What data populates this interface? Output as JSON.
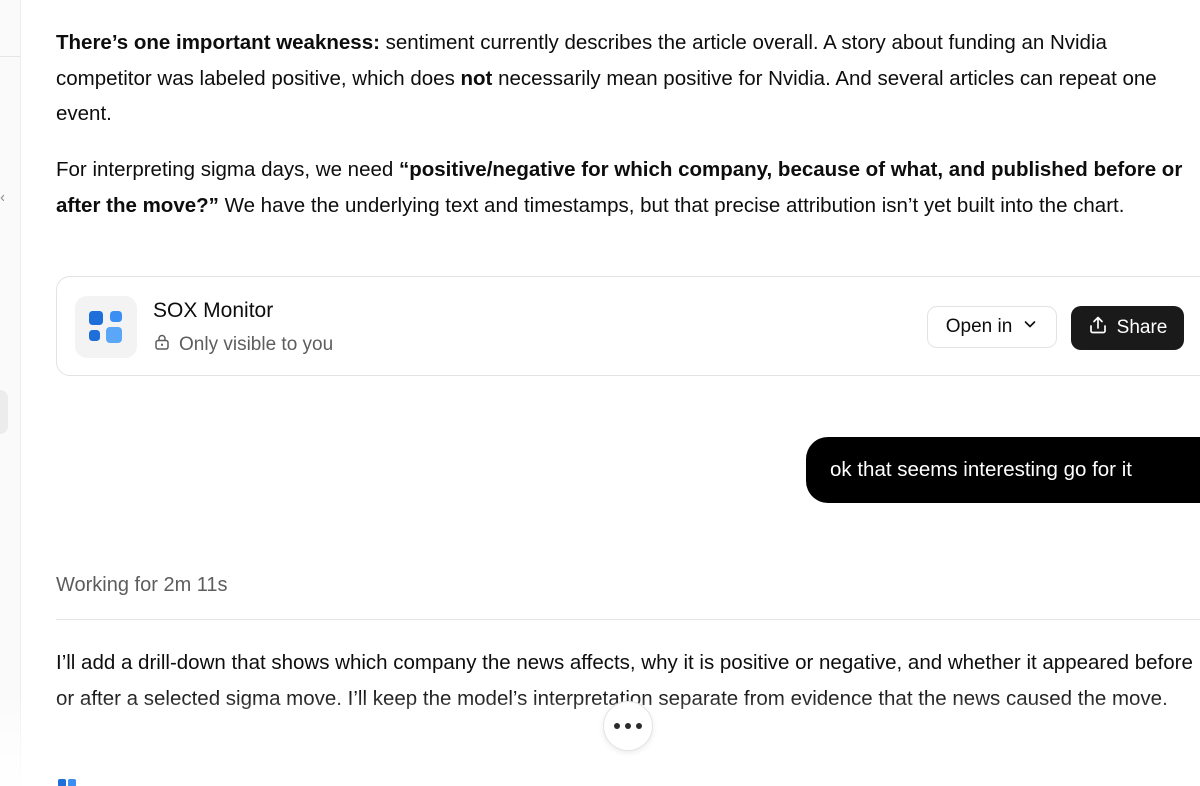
{
  "messages": {
    "assistant_1": {
      "p1_bold": "There’s one important weakness:",
      "p1_a": " sentiment currently describes the article overall. A story about funding an Nvidia competitor was labeled positive, which does ",
      "p1_bold2": "not",
      "p1_b": " necessarily mean positive for Nvidia. And several articles can repeat one event.",
      "p2_a": "For interpreting sigma days, we need ",
      "p2_bold": "“positive/negative for which company, because of what, and published before or after the move?”",
      "p2_b": " We have the underlying text and timestamps, but that precise attribution isn’t yet built into the chart."
    },
    "user_1": "ok that seems interesting go for it",
    "assistant_2": {
      "working": "Working for 2m 11s",
      "p1": "I’ll add a drill-down that shows which company the news affects, why it is positive or negative, and whether it appeared before or after a selected sigma move. I’ll keep the model’s interpretation separate from evidence that the news caused the move."
    }
  },
  "artifact_card": {
    "title": "SOX Monitor",
    "visibility": "Only visible to you",
    "open_label": "Open in",
    "share_label": "Share",
    "icon": "app-grid-icon",
    "icon_colors": [
      "#1e6fd9",
      "#3b8ff2",
      "#5aa6f7"
    ]
  },
  "icons": {
    "lock": "lock-icon",
    "chevron": "chevron-down-icon",
    "share": "share-upload-icon",
    "more": "more-dots-icon"
  }
}
